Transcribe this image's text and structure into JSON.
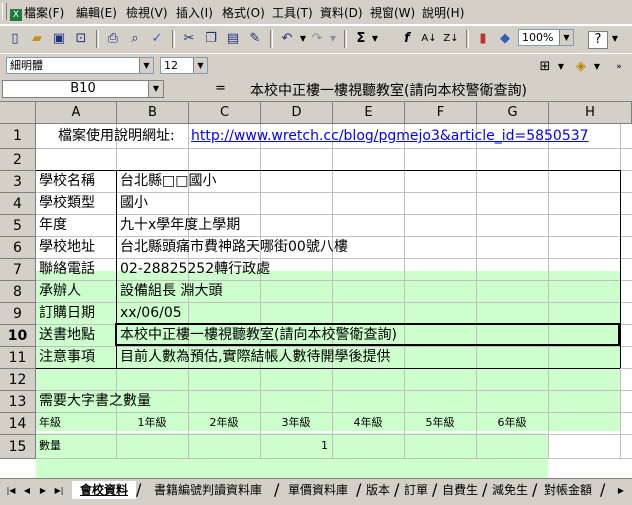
{
  "menubar": {
    "items": [
      "檔案(F)",
      "編輯(E)",
      "檢視(V)",
      "插入(I)",
      "格式(O)",
      "工具(T)",
      "資料(D)",
      "視窗(W)",
      "說明(H)"
    ]
  },
  "toolbar": {
    "zoom": "100%",
    "font_name": "細明體",
    "font_size": "12"
  },
  "formula_bar": {
    "name_box": "B10",
    "equals": "=",
    "content": "本校中正樓一樓視聽教室(請向本校警衛查詢)"
  },
  "columns": [
    "A",
    "B",
    "C",
    "D",
    "E",
    "F",
    "G",
    "H"
  ],
  "rows": [
    "1",
    "2",
    "3",
    "4",
    "5",
    "6",
    "7",
    "8",
    "9",
    "10",
    "11",
    "12",
    "13",
    "14",
    "15"
  ],
  "active_row": "10",
  "sheet": {
    "r1_label": "檔案使用說明網址:",
    "r1_link": "http://www.wretch.cc/blog/pgmejo3&article_id=5850537",
    "fields": [
      {
        "label": "學校名稱",
        "value": "台北縣□□國小"
      },
      {
        "label": "學校類型",
        "value": "國小"
      },
      {
        "label": "年度",
        "value": "九十x學年度上學期"
      },
      {
        "label": "學校地址",
        "value": "台北縣頭痛市費神路天哪街00號八樓"
      },
      {
        "label": "聯絡電話",
        "value": "02-28825252轉行政處"
      },
      {
        "label": "承辦人",
        "value": "設備組長 淵大頭"
      },
      {
        "label": "訂購日期",
        "value": "xx/06/05"
      },
      {
        "label": "送書地點",
        "value": "本校中正樓一樓視聽教室(請向本校警衛查詢)"
      },
      {
        "label": "注意事項",
        "value": "目前人數為預估,實際結帳人數待開學後提供"
      }
    ],
    "r13_label": "需要大字書之數量",
    "r14_label": "年級",
    "grades": [
      "1年級",
      "2年級",
      "3年級",
      "4年級",
      "5年級",
      "6年級"
    ],
    "r15_label": "數量",
    "quantities": [
      "",
      "",
      "1",
      "",
      "",
      ""
    ]
  },
  "tabs": {
    "items": [
      "會校資料",
      "書籍編號判讀資料庫",
      "單價資料庫",
      "版本",
      "訂單",
      "自費生",
      "減免生",
      "對帳金額"
    ],
    "active": "會校資料"
  },
  "colors": {
    "input_fill": "#ccffcc",
    "link": "#0000ff"
  }
}
